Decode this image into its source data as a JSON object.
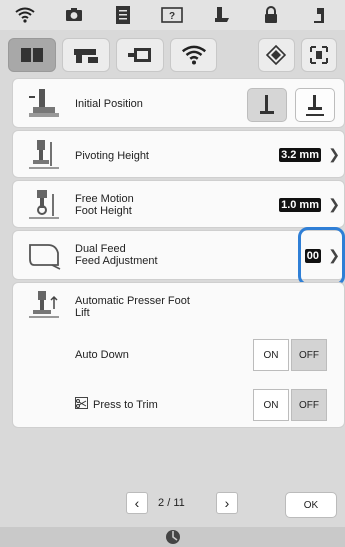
{
  "settings": {
    "initial_position": {
      "label": "Initial Position"
    },
    "pivoting_height": {
      "label": "Pivoting Height",
      "value": "3.2 mm"
    },
    "free_motion_foot_height": {
      "label_line1": "Free Motion",
      "label_line2": "Foot Height",
      "value": "1.0 mm"
    },
    "dual_feed_adjustment": {
      "label_line1": "Dual Feed",
      "label_line2": "Feed Adjustment",
      "value": "00"
    },
    "automatic_presser_foot_lift": {
      "label_line1": "Automatic Presser Foot",
      "label_line2": "Lift"
    },
    "auto_down": {
      "label": "Auto Down",
      "on_label": "ON",
      "off_label": "OFF"
    },
    "press_to_trim": {
      "label": "Press to Trim",
      "on_label": "ON",
      "off_label": "OFF"
    }
  },
  "pagination": {
    "current": "2",
    "separator": "/",
    "total": "11"
  },
  "actions": {
    "ok_label": "OK"
  },
  "colors": {
    "highlight": "#2f7fd6"
  }
}
